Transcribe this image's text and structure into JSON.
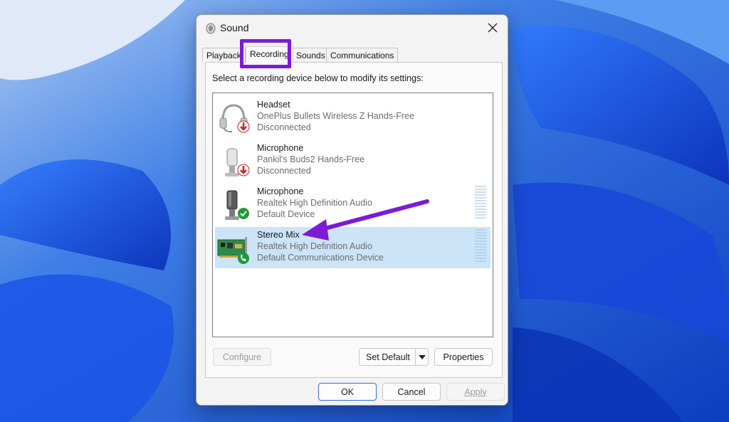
{
  "dialog": {
    "title": "Sound",
    "tabs": [
      {
        "label": "Playback",
        "active": false
      },
      {
        "label": "Recording",
        "active": true
      },
      {
        "label": "Sounds",
        "active": false
      },
      {
        "label": "Communications",
        "active": false
      }
    ],
    "instruction": "Select a recording device below to modify its settings:",
    "devices": [
      {
        "name": "Headset",
        "description": "OnePlus Bullets Wireless Z Hands-Free",
        "status": "Disconnected",
        "icon": "headset-icon",
        "badge": "disconnected-badge-icon",
        "selected": false
      },
      {
        "name": "Microphone",
        "description": "Pankil's Buds2 Hands-Free",
        "status": "Disconnected",
        "icon": "microphone-icon",
        "badge": "disconnected-badge-icon",
        "selected": false
      },
      {
        "name": "Microphone",
        "description": "Realtek High Definition Audio",
        "status": "Default Device",
        "icon": "microphone-icon",
        "badge": "default-check-badge-icon",
        "selected": false
      },
      {
        "name": "Stereo Mix",
        "description": "Realtek High Definition Audio",
        "status": "Default Communications Device",
        "icon": "sound-card-icon",
        "badge": "default-communications-badge-icon",
        "selected": true
      }
    ],
    "buttons": {
      "configure": "Configure",
      "set_default": "Set Default",
      "properties": "Properties",
      "ok": "OK",
      "cancel": "Cancel",
      "apply": "Apply"
    }
  },
  "colors": {
    "annotation": "#7b1bd6",
    "selection": "#cce4f7",
    "disconnected_badge": "#d21f1f",
    "default_badge": "#1e9a3a",
    "primary_border": "#2f6fd6"
  }
}
